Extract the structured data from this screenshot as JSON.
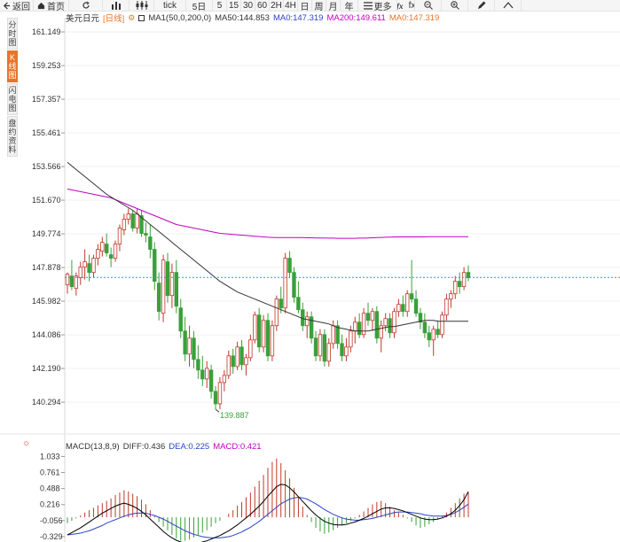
{
  "toolbar": {
    "items": [
      {
        "icon": "back-arrow-icon",
        "label": "返回"
      },
      {
        "icon": "home-icon",
        "label": "首页"
      },
      {
        "icon": "refresh-icon",
        "label": ""
      },
      {
        "icon": "bar-chart-icon",
        "label": ""
      },
      {
        "icon": "candle-icon",
        "label": ""
      },
      {
        "icon": "",
        "label": "tick"
      },
      {
        "icon": "",
        "label": "5日"
      },
      {
        "icon": "",
        "label": "5"
      },
      {
        "icon": "",
        "label": "15"
      },
      {
        "icon": "",
        "label": "30"
      },
      {
        "icon": "",
        "label": "60"
      },
      {
        "icon": "",
        "label": "2H"
      },
      {
        "icon": "",
        "label": "4H"
      },
      {
        "icon": "",
        "label": "日"
      },
      {
        "icon": "",
        "label": "周"
      },
      {
        "icon": "",
        "label": "月"
      },
      {
        "icon": "",
        "label": "年"
      },
      {
        "icon": "menu-icon",
        "label": "更多"
      },
      {
        "icon": "fx-icon",
        "label": "fx"
      },
      {
        "icon": "zoom-out-icon",
        "label": ""
      },
      {
        "icon": "zoom-in-icon",
        "label": ""
      },
      {
        "icon": "pen-icon",
        "label": ""
      },
      {
        "icon": "collapse-up-icon",
        "label": ""
      }
    ]
  },
  "sidebar": {
    "items": [
      {
        "label": "分时图",
        "active": false
      },
      {
        "label": "K线图",
        "active": true
      },
      {
        "label": "闪电图",
        "active": false
      },
      {
        "label": "盘约资料",
        "active": false
      }
    ]
  },
  "main_legend": {
    "symbol": "美元日元",
    "period": "[日线]",
    "ma1": "MA1(50,0,200,0)",
    "ma50": "MA50:144.853",
    "ma0a": "MA0:147.319",
    "ma200": "MA200:149.611",
    "ma0b": "MA0:147.319"
  },
  "macd_legend": {
    "title": "MACD(13,8,9)",
    "diff": "DIFF:0.436",
    "dea": "DEA:0.225",
    "macd": "MACD:0.421"
  },
  "colors": {
    "up": "#c0392b",
    "down": "#3aa03a",
    "ma50": "#333333",
    "ma200": "#c000c0",
    "diff": "#000000",
    "dea": "#2a44c8",
    "dashed": "#3b8fd9",
    "accent": "#e8742b"
  },
  "chart_data": [
    {
      "type": "candlestick",
      "title": "美元日元",
      "y_ticks": [
        "161.149",
        "159.253",
        "157.357",
        "155.461",
        "153.566",
        "151.670",
        "149.774",
        "147.878",
        "145.982",
        "144.086",
        "142.190",
        "140.294"
      ],
      "ylim": [
        139.3,
        161.6
      ],
      "last_price": 147.319,
      "low_annotation": "139.887",
      "low_value": 139.887,
      "candles": [
        [
          146.9,
          147.6,
          146.4,
          147.5
        ],
        [
          147.4,
          148.3,
          146.6,
          146.8
        ],
        [
          146.7,
          147.6,
          146.3,
          147.4
        ],
        [
          147.3,
          148.2,
          146.9,
          147.9
        ],
        [
          147.9,
          148.9,
          147.2,
          148.2
        ],
        [
          148.1,
          148.6,
          147.1,
          147.6
        ],
        [
          147.6,
          148.6,
          147.3,
          148.4
        ],
        [
          148.4,
          149.2,
          148.0,
          148.9
        ],
        [
          148.8,
          149.6,
          148.5,
          149.3
        ],
        [
          149.2,
          149.8,
          148.5,
          148.7
        ],
        [
          148.6,
          149.0,
          147.9,
          148.4
        ],
        [
          148.4,
          149.4,
          148.2,
          149.2
        ],
        [
          149.2,
          150.3,
          148.8,
          150.1
        ],
        [
          150.0,
          150.9,
          149.7,
          150.6
        ],
        [
          150.6,
          151.2,
          150.3,
          150.9
        ],
        [
          150.9,
          151.1,
          149.9,
          150.1
        ],
        [
          150.1,
          151.2,
          149.8,
          150.9
        ],
        [
          150.8,
          151.1,
          149.6,
          149.8
        ],
        [
          149.8,
          150.4,
          149.3,
          149.7
        ],
        [
          149.6,
          150.3,
          148.4,
          148.9
        ],
        [
          148.9,
          149.3,
          146.6,
          147.1
        ],
        [
          147.0,
          147.6,
          144.9,
          145.4
        ],
        [
          145.3,
          148.6,
          144.8,
          148.3
        ],
        [
          148.2,
          148.7,
          145.9,
          146.3
        ],
        [
          146.3,
          148.1,
          145.6,
          147.6
        ],
        [
          147.6,
          148.3,
          145.3,
          145.7
        ],
        [
          145.6,
          146.1,
          143.9,
          144.3
        ],
        [
          144.3,
          145.1,
          142.6,
          143.0
        ],
        [
          143.0,
          144.6,
          142.3,
          143.9
        ],
        [
          143.9,
          144.3,
          142.2,
          142.7
        ],
        [
          142.7,
          143.5,
          141.6,
          142.1
        ],
        [
          142.1,
          142.9,
          141.2,
          141.6
        ],
        [
          141.6,
          142.6,
          141.1,
          142.2
        ],
        [
          142.1,
          142.4,
          140.5,
          140.9
        ],
        [
          140.9,
          141.2,
          139.9,
          140.2
        ],
        [
          140.2,
          141.7,
          139.9,
          141.4
        ],
        [
          141.4,
          142.1,
          140.9,
          141.8
        ],
        [
          141.8,
          143.2,
          141.6,
          142.9
        ],
        [
          142.9,
          143.3,
          141.9,
          142.3
        ],
        [
          142.3,
          143.7,
          142.1,
          143.4
        ],
        [
          143.4,
          143.8,
          142.1,
          142.4
        ],
        [
          142.4,
          143.0,
          141.8,
          142.8
        ],
        [
          142.8,
          144.1,
          142.6,
          143.8
        ],
        [
          143.8,
          145.4,
          143.6,
          145.2
        ],
        [
          145.2,
          145.6,
          143.1,
          143.4
        ],
        [
          143.4,
          145.2,
          143.1,
          144.9
        ],
        [
          144.9,
          145.3,
          142.6,
          142.9
        ],
        [
          142.9,
          144.9,
          142.6,
          144.6
        ],
        [
          144.6,
          146.3,
          144.3,
          146.1
        ],
        [
          146.1,
          146.8,
          145.3,
          145.6
        ],
        [
          145.6,
          148.7,
          145.3,
          148.4
        ],
        [
          148.4,
          148.8,
          147.3,
          147.6
        ],
        [
          147.6,
          147.9,
          145.9,
          146.2
        ],
        [
          146.2,
          147.1,
          145.3,
          145.5
        ],
        [
          145.5,
          145.9,
          144.3,
          144.6
        ],
        [
          144.6,
          145.4,
          143.9,
          145.1
        ],
        [
          145.1,
          145.4,
          143.6,
          143.9
        ],
        [
          143.9,
          144.3,
          142.6,
          142.9
        ],
        [
          142.9,
          144.4,
          142.6,
          144.1
        ],
        [
          144.1,
          144.4,
          142.3,
          142.6
        ],
        [
          142.6,
          143.9,
          142.3,
          143.6
        ],
        [
          143.6,
          144.9,
          143.3,
          144.6
        ],
        [
          144.6,
          144.9,
          143.3,
          143.6
        ],
        [
          143.6,
          144.1,
          142.6,
          142.9
        ],
        [
          142.9,
          143.9,
          142.6,
          143.4
        ],
        [
          143.4,
          144.6,
          143.1,
          144.3
        ],
        [
          144.3,
          145.1,
          143.6,
          144.8
        ],
        [
          144.8,
          145.3,
          143.9,
          144.1
        ],
        [
          144.1,
          145.6,
          143.9,
          145.3
        ],
        [
          145.3,
          145.9,
          144.6,
          144.9
        ],
        [
          144.9,
          145.6,
          144.3,
          145.4
        ],
        [
          145.4,
          145.7,
          143.6,
          143.9
        ],
        [
          143.9,
          144.9,
          143.1,
          144.6
        ],
        [
          144.6,
          145.3,
          144.3,
          145.0
        ],
        [
          145.0,
          145.3,
          143.9,
          144.2
        ],
        [
          144.2,
          145.6,
          143.9,
          145.4
        ],
        [
          145.4,
          146.1,
          145.1,
          145.8
        ],
        [
          145.8,
          146.3,
          145.1,
          145.4
        ],
        [
          145.4,
          146.6,
          145.1,
          146.4
        ],
        [
          146.4,
          148.3,
          145.9,
          146.1
        ],
        [
          146.1,
          146.6,
          145.1,
          145.3
        ],
        [
          145.3,
          145.6,
          144.4,
          144.8
        ],
        [
          144.8,
          145.3,
          143.9,
          144.2
        ],
        [
          144.2,
          144.6,
          143.4,
          143.8
        ],
        [
          143.8,
          144.6,
          142.9,
          144.4
        ],
        [
          144.4,
          144.9,
          143.9,
          144.1
        ],
        [
          144.1,
          145.4,
          143.9,
          145.2
        ],
        [
          145.2,
          146.4,
          144.9,
          146.1
        ],
        [
          146.1,
          146.6,
          145.6,
          146.4
        ],
        [
          146.4,
          147.4,
          146.1,
          147.1
        ],
        [
          147.1,
          147.6,
          146.4,
          146.8
        ],
        [
          146.8,
          147.9,
          146.6,
          147.6
        ],
        [
          147.6,
          148.0,
          147.1,
          147.3
        ]
      ],
      "ma50": [
        153.8,
        153.6,
        153.4,
        153.2,
        153.0,
        152.8,
        152.6,
        152.4,
        152.2,
        152.0,
        151.85,
        151.7,
        151.55,
        151.4,
        151.25,
        151.1,
        150.9,
        150.7,
        150.5,
        150.3,
        150.1,
        149.9,
        149.7,
        149.5,
        149.3,
        149.1,
        148.9,
        148.7,
        148.5,
        148.3,
        148.1,
        147.9,
        147.7,
        147.5,
        147.3,
        147.1,
        146.95,
        146.8,
        146.65,
        146.5,
        146.4,
        146.3,
        146.2,
        146.1,
        146.0,
        145.9,
        145.8,
        145.7,
        145.6,
        145.5,
        145.4,
        145.3,
        145.2,
        145.1,
        145.0,
        144.95,
        144.9,
        144.85,
        144.8,
        144.75,
        144.7,
        144.6,
        144.5,
        144.45,
        144.4,
        144.35,
        144.3,
        144.3,
        144.3,
        144.3,
        144.35,
        144.4,
        144.45,
        144.5,
        144.55,
        144.55,
        144.6,
        144.65,
        144.7,
        144.75,
        144.8,
        144.85,
        144.9,
        144.9,
        144.9,
        144.85,
        144.85,
        144.85,
        144.85,
        144.85,
        144.85,
        144.85,
        144.85
      ],
      "ma200": [
        152.3,
        152.25,
        152.2,
        152.15,
        152.1,
        152.05,
        152.0,
        151.95,
        151.9,
        151.85,
        151.8,
        151.7,
        151.6,
        151.5,
        151.4,
        151.3,
        151.2,
        151.1,
        151.0,
        150.9,
        150.8,
        150.7,
        150.6,
        150.5,
        150.4,
        150.3,
        150.25,
        150.2,
        150.15,
        150.1,
        150.05,
        150.0,
        149.95,
        149.9,
        149.85,
        149.8,
        149.78,
        149.76,
        149.74,
        149.72,
        149.7,
        149.68,
        149.66,
        149.64,
        149.62,
        149.6,
        149.58,
        149.57,
        149.56,
        149.56,
        149.56,
        149.56,
        149.56,
        149.56,
        149.56,
        149.55,
        149.55,
        149.54,
        149.54,
        149.54,
        149.53,
        149.53,
        149.52,
        149.52,
        149.52,
        149.52,
        149.52,
        149.53,
        149.53,
        149.54,
        149.55,
        149.56,
        149.57,
        149.58,
        149.59,
        149.6,
        149.6,
        149.6,
        149.6,
        149.6,
        149.6,
        149.6,
        149.6,
        149.61,
        149.61,
        149.61,
        149.61,
        149.61,
        149.61,
        149.61,
        149.61,
        149.61,
        149.611
      ]
    },
    {
      "type": "macd",
      "title": "MACD(13,8,9)",
      "y_ticks": [
        "1.033",
        "0.761",
        "0.488",
        "0.216",
        "-0.056",
        "-0.329"
      ],
      "ylim": [
        -0.42,
        1.1
      ],
      "histogram": [
        -0.1,
        -0.06,
        -0.02,
        0.03,
        0.08,
        0.12,
        0.16,
        0.2,
        0.24,
        0.28,
        0.32,
        0.38,
        0.42,
        0.46,
        0.44,
        0.4,
        0.36,
        0.3,
        0.22,
        0.12,
        0.02,
        -0.08,
        -0.16,
        -0.22,
        -0.3,
        -0.36,
        -0.4,
        -0.4,
        -0.38,
        -0.34,
        -0.3,
        -0.26,
        -0.22,
        -0.16,
        -0.1,
        -0.06,
        0.0,
        0.06,
        0.12,
        0.2,
        0.26,
        0.34,
        0.42,
        0.52,
        0.62,
        0.72,
        0.84,
        0.94,
        1.0,
        0.92,
        0.8,
        0.66,
        0.5,
        0.34,
        0.18,
        0.04,
        -0.08,
        -0.18,
        -0.24,
        -0.28,
        -0.26,
        -0.22,
        -0.18,
        -0.14,
        -0.1,
        -0.06,
        -0.02,
        0.04,
        0.1,
        0.16,
        0.22,
        0.26,
        0.28,
        0.24,
        0.18,
        0.12,
        0.08,
        0.04,
        -0.02,
        -0.08,
        -0.14,
        -0.18,
        -0.16,
        -0.12,
        -0.08,
        -0.04,
        0.02,
        0.08,
        0.16,
        0.24,
        0.32,
        0.4,
        0.42
      ],
      "diff": [
        -0.3,
        -0.26,
        -0.22,
        -0.18,
        -0.13,
        -0.08,
        -0.03,
        0.02,
        0.07,
        0.11,
        0.15,
        0.19,
        0.22,
        0.24,
        0.22,
        0.19,
        0.15,
        0.1,
        0.04,
        -0.03,
        -0.1,
        -0.17,
        -0.24,
        -0.3,
        -0.35,
        -0.39,
        -0.42,
        -0.44,
        -0.45,
        -0.45,
        -0.44,
        -0.42,
        -0.4,
        -0.37,
        -0.34,
        -0.31,
        -0.27,
        -0.23,
        -0.18,
        -0.13,
        -0.07,
        -0.01,
        0.05,
        0.12,
        0.19,
        0.27,
        0.36,
        0.44,
        0.52,
        0.56,
        0.55,
        0.5,
        0.43,
        0.35,
        0.27,
        0.19,
        0.11,
        0.04,
        -0.02,
        -0.07,
        -0.1,
        -0.12,
        -0.13,
        -0.13,
        -0.12,
        -0.1,
        -0.08,
        -0.05,
        -0.02,
        0.02,
        0.06,
        0.1,
        0.14,
        0.16,
        0.16,
        0.15,
        0.13,
        0.11,
        0.08,
        0.05,
        0.02,
        -0.01,
        -0.03,
        -0.04,
        -0.04,
        -0.03,
        -0.01,
        0.02,
        0.06,
        0.12,
        0.2,
        0.3,
        0.436
      ],
      "dea": [
        -0.3,
        -0.29,
        -0.28,
        -0.27,
        -0.25,
        -0.23,
        -0.2,
        -0.17,
        -0.14,
        -0.1,
        -0.07,
        -0.04,
        -0.01,
        0.02,
        0.04,
        0.06,
        0.07,
        0.07,
        0.07,
        0.05,
        0.03,
        0.0,
        -0.03,
        -0.07,
        -0.11,
        -0.15,
        -0.19,
        -0.23,
        -0.26,
        -0.29,
        -0.31,
        -0.33,
        -0.34,
        -0.35,
        -0.35,
        -0.35,
        -0.34,
        -0.33,
        -0.31,
        -0.28,
        -0.25,
        -0.21,
        -0.17,
        -0.12,
        -0.07,
        -0.01,
        0.05,
        0.11,
        0.17,
        0.23,
        0.27,
        0.31,
        0.33,
        0.34,
        0.33,
        0.31,
        0.27,
        0.23,
        0.18,
        0.13,
        0.09,
        0.05,
        0.02,
        -0.01,
        -0.03,
        -0.04,
        -0.05,
        -0.05,
        -0.04,
        -0.03,
        -0.02,
        0.0,
        0.02,
        0.04,
        0.06,
        0.08,
        0.09,
        0.09,
        0.09,
        0.08,
        0.07,
        0.06,
        0.04,
        0.03,
        0.02,
        0.02,
        0.02,
        0.03,
        0.05,
        0.08,
        0.12,
        0.17,
        0.225
      ]
    }
  ]
}
